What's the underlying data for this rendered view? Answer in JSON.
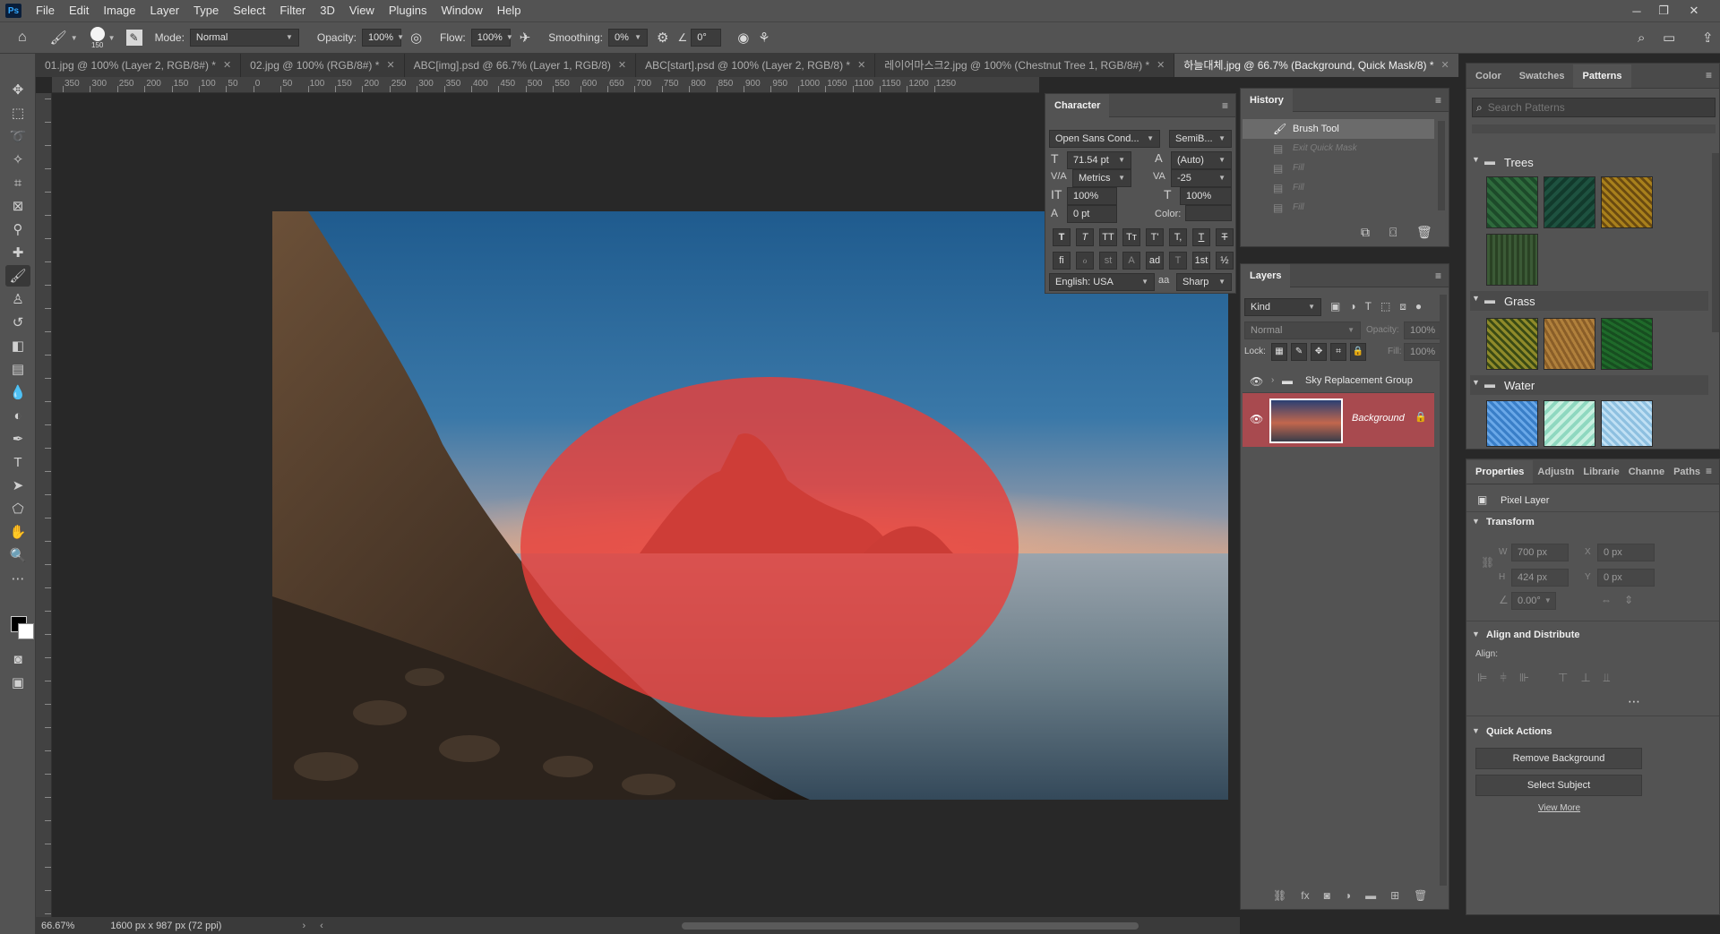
{
  "app": {
    "logo": "Ps"
  },
  "menu": [
    "File",
    "Edit",
    "Image",
    "Layer",
    "Type",
    "Select",
    "Filter",
    "3D",
    "View",
    "Plugins",
    "Window",
    "Help"
  ],
  "options": {
    "brush_size": "150",
    "mode_label": "Mode:",
    "mode_value": "Normal",
    "opacity_label": "Opacity:",
    "opacity_value": "100%",
    "flow_label": "Flow:",
    "flow_value": "100%",
    "smoothing_label": "Smoothing:",
    "smoothing_value": "0%",
    "angle_value": "0°"
  },
  "tabs": [
    {
      "label": "01.jpg @ 100% (Layer 2, RGB/8#) *"
    },
    {
      "label": "02.jpg @ 100% (RGB/8#) *"
    },
    {
      "label": "ABC[img].psd @ 66.7% (Layer 1, RGB/8)"
    },
    {
      "label": "ABC[start].psd @ 100% (Layer 2, RGB/8) *"
    },
    {
      "label": "레이어마스크2.jpg @ 100% (Chestnut Tree 1, RGB/8#) *"
    },
    {
      "label": "하늘대체.jpg @ 66.7% (Background, Quick Mask/8) *"
    }
  ],
  "ruler_h": [
    "350",
    "300",
    "250",
    "200",
    "150",
    "100",
    "50",
    "0",
    "50",
    "100",
    "150",
    "200",
    "250",
    "300",
    "350",
    "400",
    "450",
    "500",
    "550",
    "600",
    "650",
    "700",
    "750",
    "800",
    "850",
    "900",
    "950",
    "1000",
    "1050",
    "1100",
    "1150",
    "1200",
    "1250"
  ],
  "status": {
    "zoom": "66.67%",
    "doc": "1600 px x 987 px (72 ppi)"
  },
  "character": {
    "title": "Character",
    "font": "Open Sans Cond...",
    "style": "SemiB...",
    "size": "71.54 pt",
    "leading": "(Auto)",
    "kerning": "Metrics",
    "tracking": "-25",
    "vscale": "100%",
    "hscale": "100%",
    "baseline": "0 pt",
    "color_label": "Color:",
    "language": "English: USA",
    "antialias": "Sharp",
    "style_buttons": [
      "T",
      "T",
      "TT",
      "Tт",
      "T'",
      "T,",
      "T",
      "T"
    ],
    "ot_buttons": [
      "fi",
      "ℴ",
      "st",
      "A",
      "ad",
      "T",
      "1st",
      "½"
    ]
  },
  "history": {
    "title": "History",
    "items": [
      {
        "label": "Brush Tool",
        "state": "active"
      },
      {
        "label": "Exit Quick Mask",
        "state": "undone"
      },
      {
        "label": "Fill",
        "state": "undone"
      },
      {
        "label": "Fill",
        "state": "undone"
      },
      {
        "label": "Fill",
        "state": "undone"
      }
    ]
  },
  "layers": {
    "title": "Layers",
    "filter": "Kind",
    "blend": "Normal",
    "opacity_label": "Opacity:",
    "opacity": "100%",
    "lock_label": "Lock:",
    "fill_label": "Fill:",
    "fill": "100%",
    "items": [
      {
        "name": "Sky Replacement Group",
        "type": "group"
      },
      {
        "name": "Background",
        "type": "pixel",
        "selected": true
      }
    ]
  },
  "right_top": {
    "tabs": [
      "Color",
      "Swatches",
      "Patterns"
    ],
    "search_placeholder": "Search Patterns",
    "groups": [
      {
        "name": "Trees",
        "colors": [
          "#1d4a2a",
          "#123a2c",
          "#a8801c",
          "#3b5a36"
        ]
      },
      {
        "name": "Grass",
        "colors": [
          "#8f8a2a",
          "#b0803c",
          "#1f6a2a"
        ]
      },
      {
        "name": "Water",
        "colors": [
          "#3a7fc8",
          "#8fd8c0",
          "#8ec0e0"
        ]
      }
    ]
  },
  "properties": {
    "tabs": [
      "Properties",
      "Adjustn",
      "Librarie",
      "Channe",
      "Paths"
    ],
    "type": "Pixel Layer",
    "transform": "Transform",
    "w_label": "W",
    "w": "700 px",
    "h_label": "H",
    "h": "424 px",
    "x_label": "X",
    "x": "0 px",
    "y_label": "Y",
    "y": "0 px",
    "angle": "0.00°",
    "align_section": "Align and Distribute",
    "align_label": "Align:",
    "quick_actions": "Quick Actions",
    "remove_bg": "Remove Background",
    "select_subject": "Select Subject",
    "view_more": "View More"
  },
  "colors": {
    "quickmask": "#e8403a",
    "accent": "#a84a4f"
  }
}
